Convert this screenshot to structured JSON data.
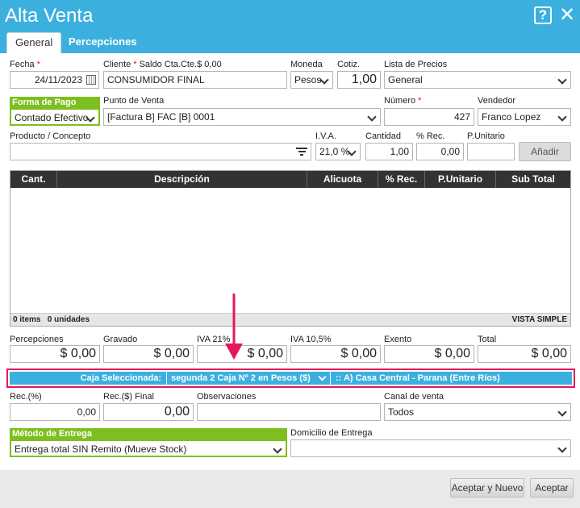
{
  "window": {
    "title": "Alta Venta",
    "help_label": "?",
    "close_label": "✕"
  },
  "tabs": [
    {
      "label": "General"
    },
    {
      "label": "Percepciones"
    }
  ],
  "form": {
    "fecha": {
      "label": "Fecha",
      "value": "24/11/2023"
    },
    "cliente": {
      "label": "Cliente",
      "saldo_label": "Saldo Cta.Cte.$ 0,00",
      "value": "CONSUMIDOR FINAL"
    },
    "moneda": {
      "label": "Moneda",
      "value": "Pesos"
    },
    "cotiz": {
      "label": "Cotiz.",
      "value": "1,00"
    },
    "lista_precios": {
      "label": "Lista de Precios",
      "value": "General"
    },
    "forma_pago": {
      "label": "Forma de Pago",
      "value": "Contado Efectivo"
    },
    "punto_venta": {
      "label": "Punto de Venta",
      "value": "[Factura B] FAC [B] 0001"
    },
    "numero": {
      "label": "Número",
      "value": "427"
    },
    "vendedor": {
      "label": "Vendedor",
      "value": "Franco Lopez"
    },
    "producto": {
      "label": "Producto / Concepto",
      "value": ""
    },
    "iva": {
      "label": "I.V.A.",
      "value": "21,0 %"
    },
    "cantidad": {
      "label": "Cantidad",
      "value": "1,00"
    },
    "rec": {
      "label": "% Rec.",
      "value": "0,00"
    },
    "punitario": {
      "label": "P.Unitario",
      "value": ""
    },
    "add_button": "Añadir"
  },
  "grid": {
    "columns": [
      "Cant.",
      "Descripción",
      "Alicuota",
      "% Rec.",
      "P.Unitario",
      "Sub Total"
    ],
    "footer_items": "0 items   0 unidades",
    "footer_view": "VISTA SIMPLE"
  },
  "totals": {
    "percepciones": {
      "label": "Percepciones",
      "value": "$ 0,00"
    },
    "gravado": {
      "label": "Gravado",
      "value": "$ 0,00"
    },
    "iva21": {
      "label": "IVA 21%",
      "value": "$ 0,00"
    },
    "iva105": {
      "label": "IVA 10,5%",
      "value": "$ 0,00"
    },
    "exento": {
      "label": "Exento",
      "value": "$ 0,00"
    },
    "total": {
      "label": "Total",
      "value": "$ 0,00"
    }
  },
  "caja": {
    "label": "Caja Seleccionada:",
    "value": "segunda 2 Caja Nº 2 en Pesos ($)",
    "sucursal": ":: A) Casa Central - Parana (Entre Ríos)"
  },
  "extras": {
    "rec_pct": {
      "label": "Rec.(%)",
      "value": "0,00"
    },
    "rec_final": {
      "label": "Rec.($) Final",
      "value": "0,00"
    },
    "observaciones": {
      "label": "Observaciones",
      "value": ""
    },
    "canal": {
      "label": "Canal de venta",
      "value": "Todos"
    },
    "metodo_entrega": {
      "label": "Método de Entrega",
      "value": "Entrega total SIN Remito (Mueve Stock)"
    },
    "domicilio": {
      "label": "Domicilio de Entrega",
      "value": ""
    }
  },
  "buttons": {
    "aceptar_nuevo": "Aceptar y Nuevo",
    "aceptar": "Aceptar"
  },
  "colors": {
    "header": "#3bb0df",
    "accent_green": "#7cbf1f",
    "highlight": "#e5175f"
  }
}
